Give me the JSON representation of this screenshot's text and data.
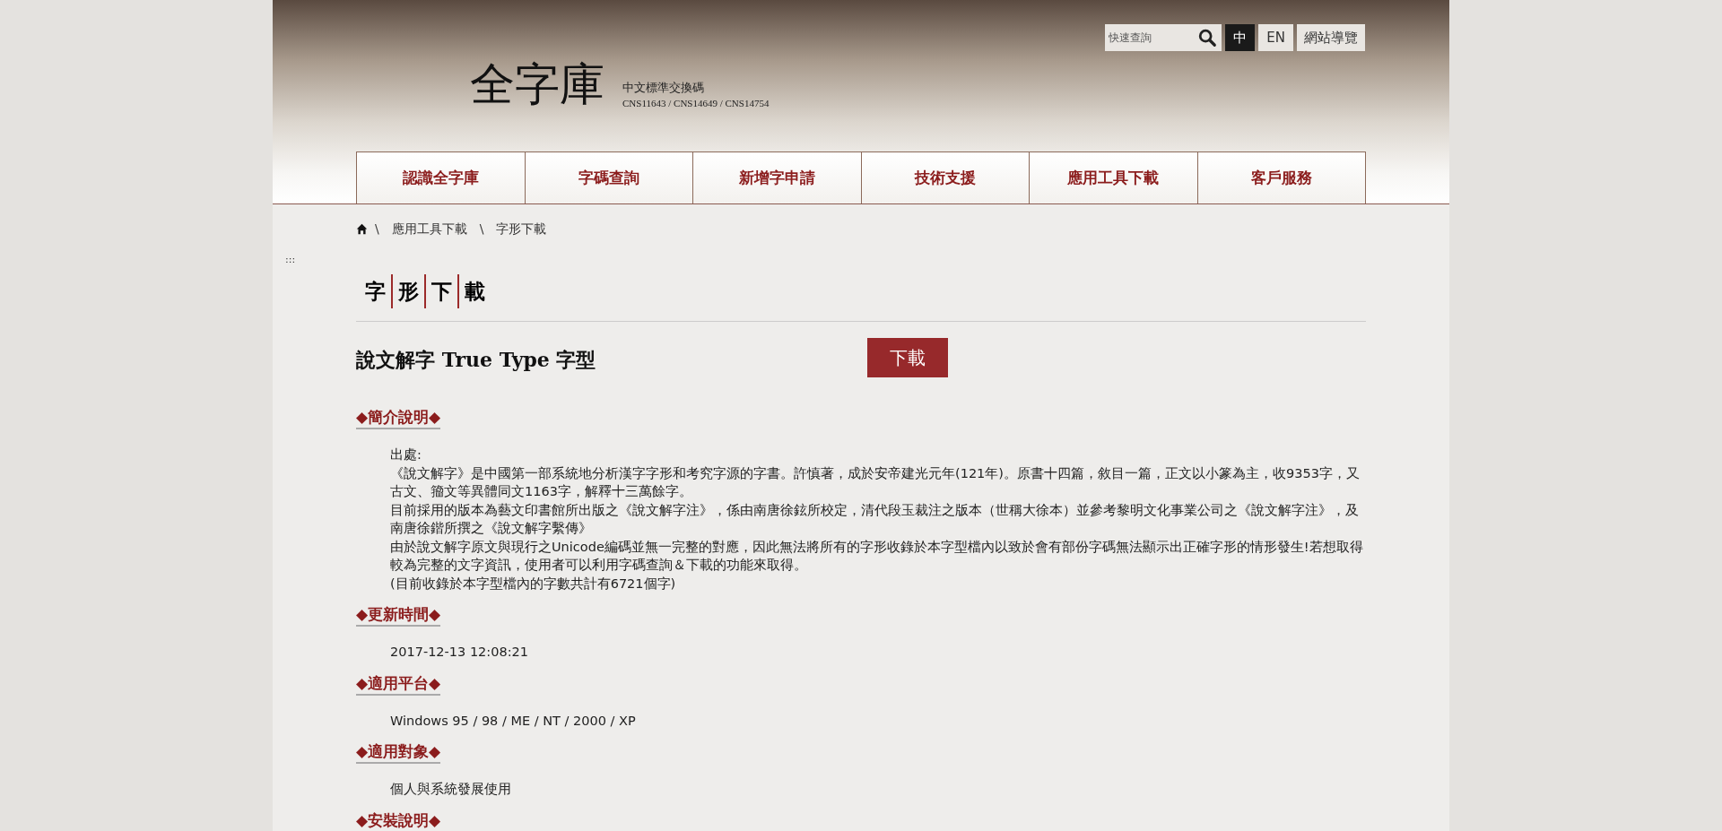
{
  "header": {
    "logo": "全字庫",
    "logo_subtitle": "中文標準交換碼",
    "logo_standards": "CNS11643 / CNS14649 / CNS14754",
    "search": {
      "placeholder": "快速查詢"
    },
    "languages": [
      {
        "label": "中",
        "selected": true
      },
      {
        "label": "EN",
        "selected": false
      }
    ],
    "sitemap": "網站導覽"
  },
  "nav": [
    "認識全字庫",
    "字碼查詢",
    "新增字申請",
    "技術支援",
    "應用工具下載",
    "客戶服務"
  ],
  "breadcrumb": [
    "應用工具下載",
    "字形下載"
  ],
  "breadcrumb_separator": "\\",
  "accesskey": ":::",
  "page_title_chars": [
    "字",
    "形",
    "下",
    "載"
  ],
  "item": {
    "title": "說文解字 True Type 字型",
    "download": "下載"
  },
  "sections": [
    {
      "heading": "◆簡介說明◆",
      "paragraphs": [
        "出處:",
        "《說文解字》是中國第一部系統地分析漢字字形和考究字源的字書。許慎著，成於安帝建光元年(121年)。原書十四篇，敘目一篇，正文以小篆為主，收9353字，又古文、籀文等異體同文1163字，解釋十三萬餘字。",
        "目前採用的版本為藝文印書館所出版之《說文解字注》，係由南唐徐鉉所校定，清代段玉裁注之版本（世稱大徐本）並參考黎明文化事業公司之《說文解字注》，及南唐徐鍇所撰之《說文解字繫傳》",
        "由於說文解字原文與現行之Unicode編碼並無一完整的對應，因此無法將所有的字形收錄於本字型檔內以致於會有部份字碼無法顯示出正確字形的情形發生!若想取得較為完整的文字資訊，使用者可以利用字碼查詢＆下載的功能來取得。",
        "(目前收錄於本字型檔內的字數共計有6721個字)"
      ]
    },
    {
      "heading": "◆更新時間◆",
      "paragraphs": [
        "2017-12-13 12:08:21"
      ]
    },
    {
      "heading": "◆適用平台◆",
      "paragraphs": [
        "Windows 95 / 98 / ME / NT / 2000 / XP"
      ]
    },
    {
      "heading": "◆適用對象◆",
      "paragraphs": [
        "個人與系統發展使用"
      ]
    },
    {
      "heading": "◆安裝說明◆"
    }
  ]
}
